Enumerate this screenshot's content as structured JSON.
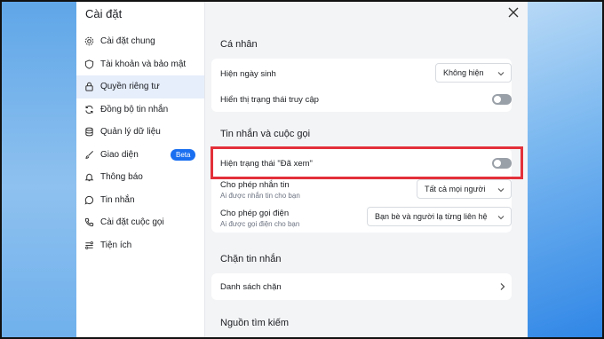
{
  "sidebar": {
    "title": "Cài đặt",
    "items": [
      {
        "label": "Cài đặt chung",
        "icon": "gear-icon"
      },
      {
        "label": "Tài khoản và bảo mật",
        "icon": "shield-icon"
      },
      {
        "label": "Quyền riêng tư",
        "icon": "lock-icon"
      },
      {
        "label": "Đồng bộ tin nhắn",
        "icon": "sync-icon"
      },
      {
        "label": "Quản lý dữ liệu",
        "icon": "database-icon"
      },
      {
        "label": "Giao diện",
        "icon": "brush-icon",
        "badge": "Beta"
      },
      {
        "label": "Thông báo",
        "icon": "bell-icon"
      },
      {
        "label": "Tin nhắn",
        "icon": "chat-icon"
      },
      {
        "label": "Cài đặt cuộc gọi",
        "icon": "phone-icon"
      },
      {
        "label": "Tiện ích",
        "icon": "utilities-icon"
      }
    ],
    "active_index": 2
  },
  "main": {
    "personal": {
      "title": "Cá nhân",
      "birthday_label": "Hiện ngày sinh",
      "birthday_value": "Không hiện",
      "access_status_label": "Hiển thị trạng thái truy cập",
      "access_status_on": false
    },
    "messages_calls": {
      "title": "Tin nhắn và cuộc gọi",
      "seen_label": "Hiện trạng thái \"Đã xem\"",
      "seen_on": false,
      "allow_messages_label": "Cho phép nhắn tin",
      "allow_messages_sub": "Ai được nhắn tin cho bạn",
      "allow_messages_value": "Tất cả mọi người",
      "allow_calls_label": "Cho phép gọi điện",
      "allow_calls_sub": "Ai được gọi điện cho bạn",
      "allow_calls_value": "Bạn bè và người lạ từng liên hệ"
    },
    "block": {
      "title": "Chặn tin nhắn",
      "list_label": "Danh sách chặn"
    },
    "search_source": {
      "title": "Nguồn tìm kiếm"
    }
  },
  "colors": {
    "accent": "#1a6ff0",
    "highlight": "#e3303a",
    "active_bg": "#e6eefb"
  }
}
